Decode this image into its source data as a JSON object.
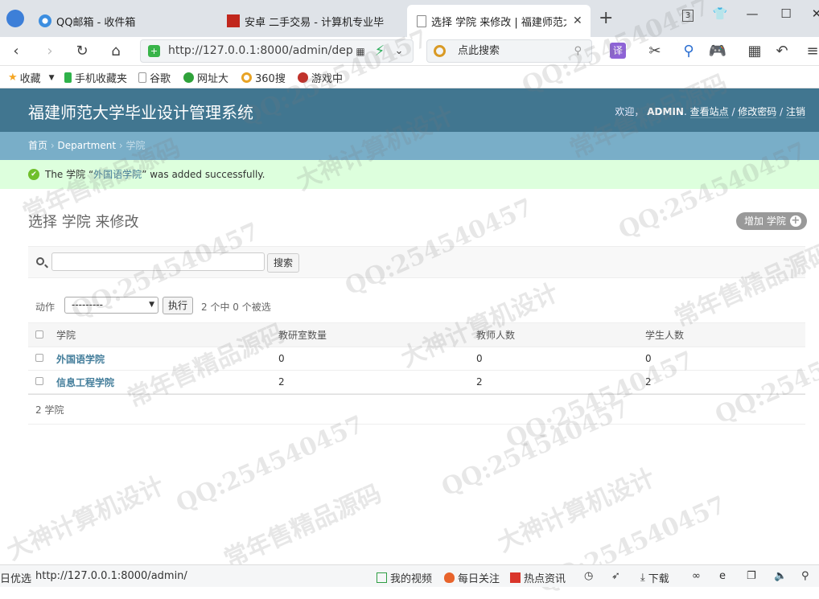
{
  "browser": {
    "tabs": [
      {
        "label": "QQ邮箱 - 收件箱",
        "icon": "qq-mail-icon"
      },
      {
        "label": "安卓 二手交易 - 计算机专业毕",
        "icon": "red-app-icon"
      },
      {
        "label": "选择 学院 来修改 | 福建师范大",
        "icon": "page-icon",
        "active": true
      }
    ],
    "new_tab_symbol": "+",
    "tab_count": "3",
    "url": "http://127.0.0.1:8000/admin/dep",
    "search_placeholder": "点此搜索",
    "translate_label": "译"
  },
  "bookmarks": [
    {
      "label": "收藏",
      "icon": "star-icon",
      "color": "#f5a623"
    },
    {
      "label": "手机收藏夹",
      "icon": "phone-icon",
      "color": "#2fb24a"
    },
    {
      "label": "谷歌",
      "icon": "page-icon",
      "color": "#bbbbbb"
    },
    {
      "label": "网址大",
      "icon": "globe-icon",
      "color": "#2fa23a"
    },
    {
      "label": "360搜",
      "icon": "search-360-icon",
      "color": "#e8a325"
    },
    {
      "label": "游戏中",
      "icon": "game-icon",
      "color": "#c0322b"
    }
  ],
  "admin": {
    "site_title": "福建师范大学毕业设计管理系统",
    "welcome": "欢迎，",
    "username": "ADMIN",
    "view_site": "查看站点",
    "change_password": "修改密码",
    "logout": "注销",
    "separator": " / "
  },
  "breadcrumbs": {
    "home": "首页",
    "app": "Department",
    "current": "学院",
    "sep": " › "
  },
  "message": {
    "prefix": "The 学院 “",
    "object": "外国语学院",
    "suffix": "” was added successfully."
  },
  "page": {
    "title": "选择 学院 来修改",
    "add_button": "增加 学院",
    "search_button": "搜索",
    "search_value": ""
  },
  "actions": {
    "label": "动作",
    "selected_option": "---------",
    "run_button": "执行",
    "counter": "2 个中 0 个被选"
  },
  "table": {
    "headers": [
      "学院",
      "教研室数量",
      "教师人数",
      "学生人数"
    ],
    "rows": [
      {
        "name": "外国语学院",
        "rooms": "0",
        "teachers": "0",
        "students": "0"
      },
      {
        "name": "信息工程学院",
        "rooms": "2",
        "teachers": "2",
        "students": "2"
      }
    ]
  },
  "paginator": "2 学院",
  "statusbar": {
    "left": "日优选",
    "url": "http://127.0.0.1:8000/admin/",
    "items": [
      "我的视频",
      "每日关注",
      "热点资讯",
      "下载"
    ]
  },
  "watermarks": [
    "QQ:254540457",
    "大神计算机设计",
    "常年售精品源码"
  ],
  "colors": {
    "header": "#417690",
    "breadcrumbs": "#79aec8",
    "success": "#ddffdd",
    "link": "#447e9b"
  }
}
